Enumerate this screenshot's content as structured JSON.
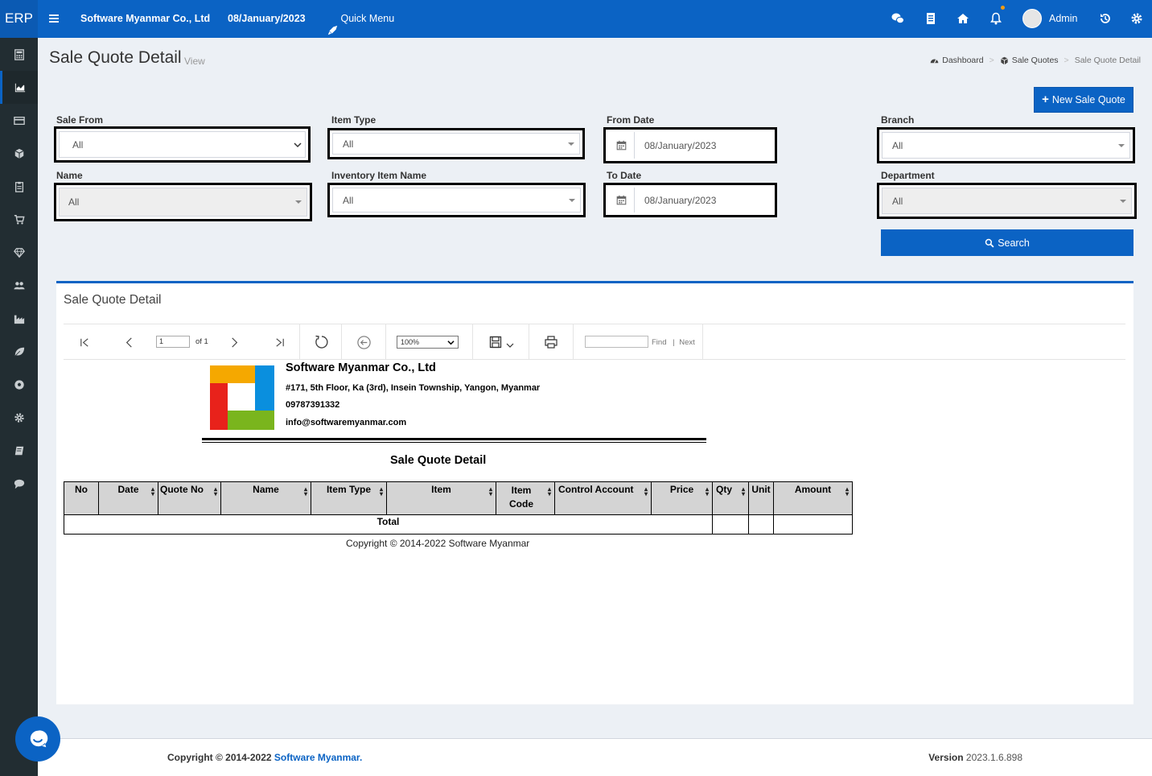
{
  "topbar": {
    "brand": "ERP",
    "company": "Software Myanmar Co., Ltd",
    "date": "08/January/2023",
    "quick_menu": "Quick Menu",
    "user": "Admin"
  },
  "header": {
    "title": "Sale Quote Detail",
    "subtitle": "View",
    "breadcrumb": [
      "Dashboard",
      "Sale Quotes",
      "Sale Quote Detail"
    ],
    "new_button": "New Sale Quote"
  },
  "filters": {
    "sale_from": {
      "label": "Sale From",
      "value": "All"
    },
    "name": {
      "label": "Name",
      "value": "All"
    },
    "item_type": {
      "label": "Item Type",
      "value": "All"
    },
    "inventory_item_name": {
      "label": "Inventory Item Name",
      "value": "All"
    },
    "from_date": {
      "label": "From Date",
      "value": "08/January/2023"
    },
    "to_date": {
      "label": "To Date",
      "value": "08/January/2023"
    },
    "branch": {
      "label": "Branch",
      "value": "All"
    },
    "department": {
      "label": "Department",
      "value": "All"
    },
    "search_button": "Search"
  },
  "report": {
    "box_title": "Sale Quote Detail",
    "toolbar": {
      "page_value": "1",
      "of_pages": "of 1",
      "zoom": "100%",
      "find": "Find",
      "next": "Next"
    },
    "company_name": "Software Myanmar Co., Ltd",
    "address": "#171, 5th Floor, Ka (3rd), Insein Township, Yangon, Myanmar",
    "phone": "09787391332",
    "email": "info@softwaremyanmar.com",
    "heading": "Sale Quote Detail",
    "columns": [
      "No",
      "Date",
      "Quote No",
      "Name",
      "Item Type",
      "Item",
      "Item Code",
      "Control Account",
      "Price",
      "Qty",
      "Unit",
      "Amount"
    ],
    "total_label": "Total",
    "copyright": "Copyright © 2014-2022 Software Myanmar",
    "logo_colors": [
      "#f5a800",
      "#0a8fde",
      "#e8221b",
      "#7ab51d"
    ]
  },
  "footer": {
    "copyright_prefix": "Copyright © 2014-2022",
    "copyright_link": "Software Myanmar.",
    "version_label": "Version",
    "version_value": "2023.1.6.898"
  }
}
